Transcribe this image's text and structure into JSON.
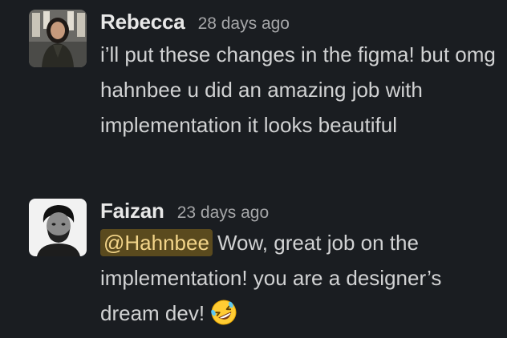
{
  "messages": [
    {
      "author": "Rebecca",
      "timestamp": "28 days ago",
      "avatar": "rebecca-avatar-photo",
      "text": "i’ll put these changes in the figma! but omg hahnbee u did an amazing job with implementation it looks beautiful"
    },
    {
      "author": "Faizan",
      "timestamp": "23 days ago",
      "avatar": "faizan-avatar-photo",
      "mention": "@Hahnbee",
      "text": "Wow, great job on the implementation! you are a designer’s dream dev!",
      "emoji": "rolling-on-the-floor-laughing-emoji"
    }
  ],
  "colors": {
    "background": "#1a1d21",
    "text": "#d1d2d3",
    "author": "#e8e8e8",
    "timestamp": "#a6a7a9",
    "mention_bg": "#5a4a1e",
    "mention_text": "#f3d58a"
  }
}
